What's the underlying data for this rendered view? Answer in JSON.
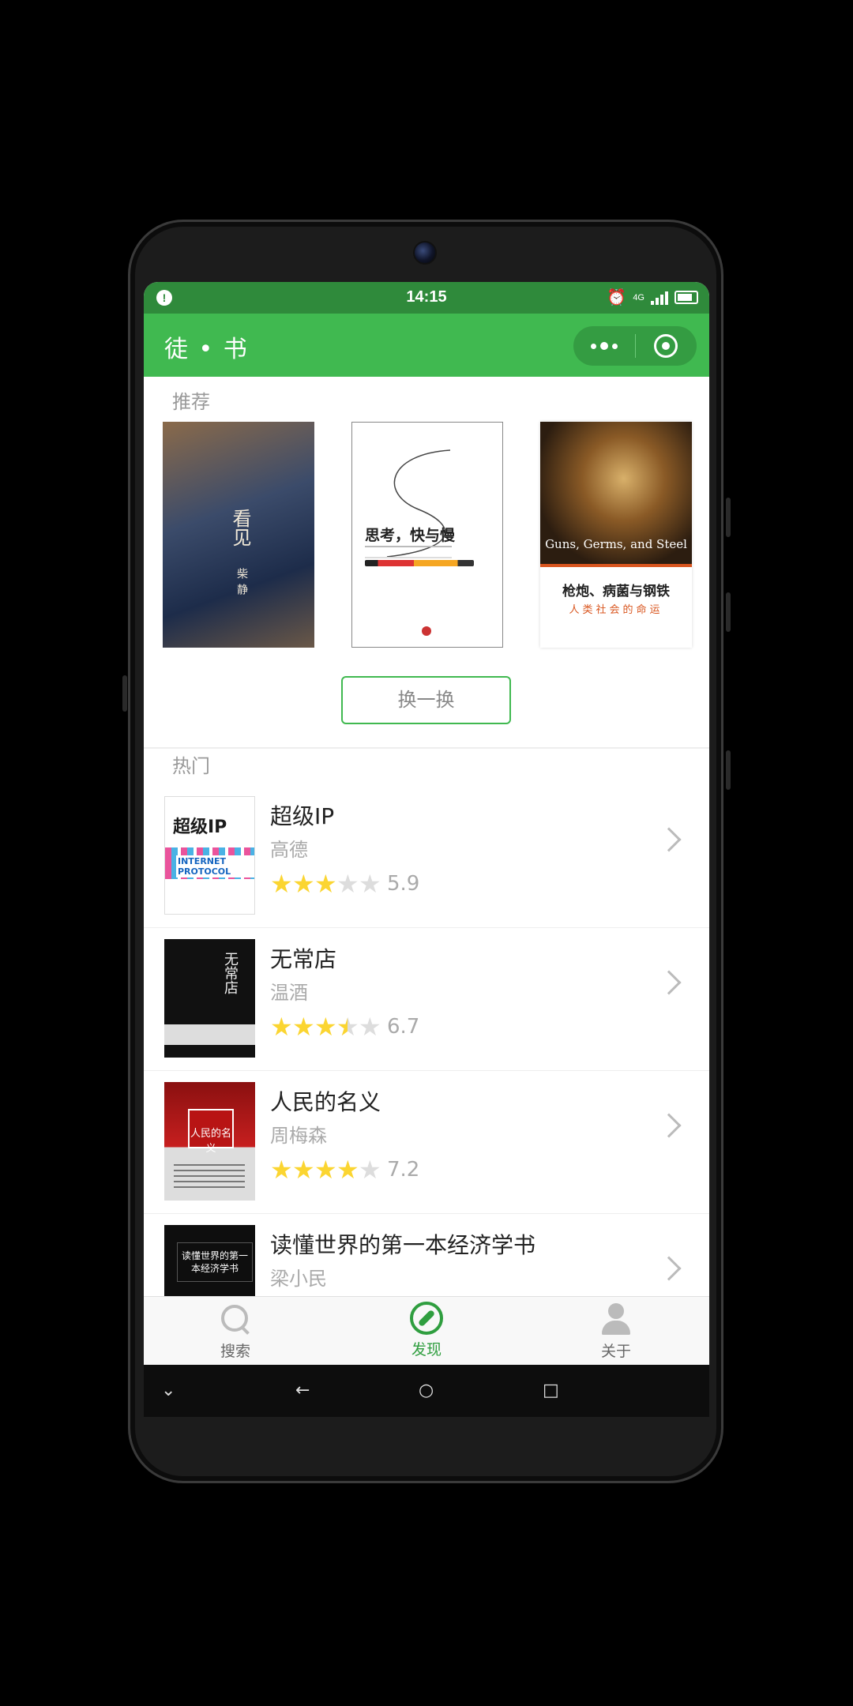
{
  "status_bar": {
    "time": "14:15",
    "notification": "!",
    "network": "4G",
    "alarm_icon": "alarm-icon",
    "signal_icon": "signal-icon",
    "battery_icon": "battery-icon"
  },
  "header": {
    "title": "徒 • 书",
    "menu_icon": "more-dots-icon",
    "close_icon": "target-icon",
    "bg_color": "#40b950",
    "status_color": "#2f8a3b"
  },
  "recommend": {
    "label": "推荐",
    "covers": [
      {
        "title": "看见",
        "author": "柴静"
      },
      {
        "title": "思考，快与慢"
      },
      {
        "title_en": "Guns, Germs, and Steel",
        "title_cn": "枪炮、病菌与钢铁",
        "subtitle": "人类社会的命运"
      }
    ],
    "refresh_label": "换一换"
  },
  "hot": {
    "label": "热门",
    "books": [
      {
        "title": "超级IP",
        "author": "高德",
        "rating": 5.9,
        "rating_text": "5.9",
        "stars": 3,
        "cover_text": "超级IP",
        "cover_sub": "INTERNET PROTOCOL"
      },
      {
        "title": "无常店",
        "author": "温酒",
        "rating": 6.7,
        "rating_text": "6.7",
        "stars": 3.5,
        "cover_text": "无常店"
      },
      {
        "title": "人民的名义",
        "author": "周梅森",
        "rating": 7.2,
        "rating_text": "7.2",
        "stars": 4,
        "cover_text": "人民的名义"
      },
      {
        "title": "读懂世界的第一本经济学书",
        "author": "梁小民",
        "cover_text": "读懂世界的第一本经济学书"
      }
    ]
  },
  "tabbar": {
    "items": [
      {
        "label": "搜索",
        "icon": "search-icon",
        "active": false
      },
      {
        "label": "发现",
        "icon": "compass-icon",
        "active": true
      },
      {
        "label": "关于",
        "icon": "user-icon",
        "active": false
      }
    ],
    "active_color": "#2f9e3f"
  },
  "android_nav": {
    "collapse": "⌄",
    "back": "←",
    "home": "○",
    "recent": "□"
  },
  "colors": {
    "star_full": "#fbd531",
    "star_empty": "#dddddd",
    "accent": "#40b950"
  }
}
